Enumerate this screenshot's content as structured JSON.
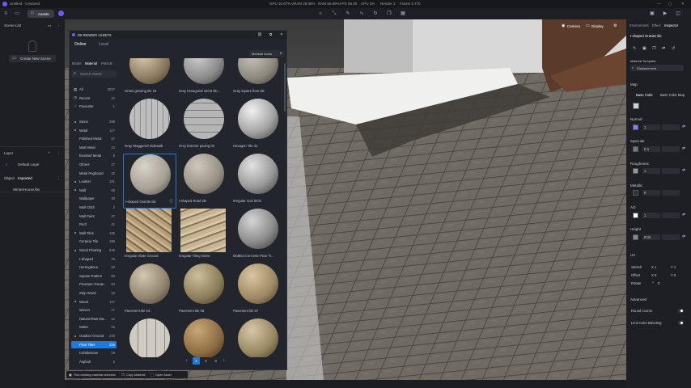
{
  "titlebar": {
    "file": "Untitled - Unsaved",
    "assets_tab": "Assets",
    "stats": [
      "GPU 10.67%",
      "VRAM 29.08%",
      "RAM 56.90%",
      "FPS 56.00",
      "CPU 3%",
      "Render 3",
      "Frame 4.770"
    ]
  },
  "left": {
    "scene_list": "Scene List",
    "create_scene": "Create New Scene",
    "layer_title": "Layer",
    "default_layer": "Default Layer",
    "object_title": "Object",
    "imported": "Imported",
    "file": "WinterHouse.fbx"
  },
  "assets": {
    "title": "D5 RENDER ASSETS",
    "tabs": [
      "Online",
      "Local"
    ],
    "subtabs": [
      "Model",
      "Material",
      "Particle"
    ],
    "search_placeholder": "Search Assets",
    "view": "Medium Icons",
    "top_list": [
      {
        "label": "All",
        "count": "2027"
      },
      {
        "label": "Recent",
        "count": "12"
      },
      {
        "label": "Favourite",
        "count": "1"
      }
    ],
    "categories": [
      {
        "label": "Stone",
        "count": "298"
      },
      {
        "label": "Metal",
        "count": "117"
      },
      {
        "label": "Polished Metal",
        "count": "27"
      },
      {
        "label": "Matt Metal",
        "count": "23"
      },
      {
        "label": "Brushed Metal",
        "count": "8"
      },
      {
        "label": "Others",
        "count": "27"
      },
      {
        "label": "Metal Pegboard",
        "count": "32"
      },
      {
        "label": "Leather",
        "count": "181"
      },
      {
        "label": "Wall",
        "count": "69"
      },
      {
        "label": "Wallpaper",
        "count": "30"
      },
      {
        "label": "Wall Cloth",
        "count": "2"
      },
      {
        "label": "Wall Paint",
        "count": "37"
      },
      {
        "label": "Roof",
        "count": "41"
      },
      {
        "label": "Wall Tiles",
        "count": "185"
      },
      {
        "label": "Ceramic Tile",
        "count": "189"
      },
      {
        "label": "Wood Flooring",
        "count": "248"
      },
      {
        "label": "I-Shaped",
        "count": "75"
      },
      {
        "label": "Herringbone",
        "count": "53"
      },
      {
        "label": "Square Pattern",
        "count": "59"
      },
      {
        "label": "Pressure-Treate...",
        "count": "54"
      },
      {
        "label": "Strip Wood",
        "count": "16"
      },
      {
        "label": "Wood",
        "count": "117"
      },
      {
        "label": "Woven",
        "count": "17"
      },
      {
        "label": "Natural Raw Ma...",
        "count": "12"
      },
      {
        "label": "Water",
        "count": "16"
      },
      {
        "label": "Outdoor Ground",
        "count": "240"
      },
      {
        "label": "Floor Tiles",
        "count": "219"
      },
      {
        "label": "Cobblestone",
        "count": "19"
      },
      {
        "label": "Asphalt",
        "count": "2"
      }
    ],
    "tiles": [
      {
        "name": "Grass growing tile 15"
      },
      {
        "name": "Gray hexagonal street tile..."
      },
      {
        "name": "Gray square floor tile"
      },
      {
        "name": "Gray Staggered Sidewalk"
      },
      {
        "name": "Grey Exterior paving 02"
      },
      {
        "name": "Hexagon Tile 31"
      },
      {
        "name": "I-shaped Granite tile"
      },
      {
        "name": "I-shaped Road tile"
      },
      {
        "name": "Irregular rock brick"
      },
      {
        "name": "Irregular Slate Ground"
      },
      {
        "name": "Irregular Tiling Stone"
      },
      {
        "name": "Mottled Concrete Floor Ti..."
      },
      {
        "name": "Pavement tile 04"
      },
      {
        "name": "Pavement tile 05"
      },
      {
        "name": "Pavement tile 07"
      },
      {
        "name": ""
      },
      {
        "name": ""
      },
      {
        "name": ""
      }
    ],
    "pages": [
      "1",
      "2",
      "3"
    ]
  },
  "footer": {
    "items": [
      "Find existing material selection",
      "Copy Material",
      "Open Asset"
    ]
  },
  "viewport": {
    "camera": "Camera",
    "display": "Display"
  },
  "right": {
    "tabs": [
      "Environment",
      "Effect",
      "Inspector"
    ],
    "material_name": "I-shaped Granite tile",
    "template_label": "Material Template",
    "template": "Displacement",
    "map": "Map",
    "base_color": "Base Color",
    "base_color_map": "Base Color Map",
    "normal": "Normal",
    "normal_val": "1",
    "specular": "Specular",
    "specular_val": "0.3",
    "roughness": "Roughness",
    "roughness_val": "1",
    "metallic": "Metallic",
    "metallic_val": "0",
    "ao": "AO",
    "ao_val": "1",
    "height": "Height",
    "height_val": "0.02",
    "uv": "UV",
    "stretch": "Stretch",
    "offset": "Offset",
    "rotate": "Rotate",
    "x1": "X 1",
    "y1": "Y 1",
    "x0": "X 0",
    "y0": "Y 0",
    "rot": "0",
    "advanced": "Advanced",
    "round_corner": "Round Corner",
    "limit_color": "Limit Color Bleeding"
  }
}
